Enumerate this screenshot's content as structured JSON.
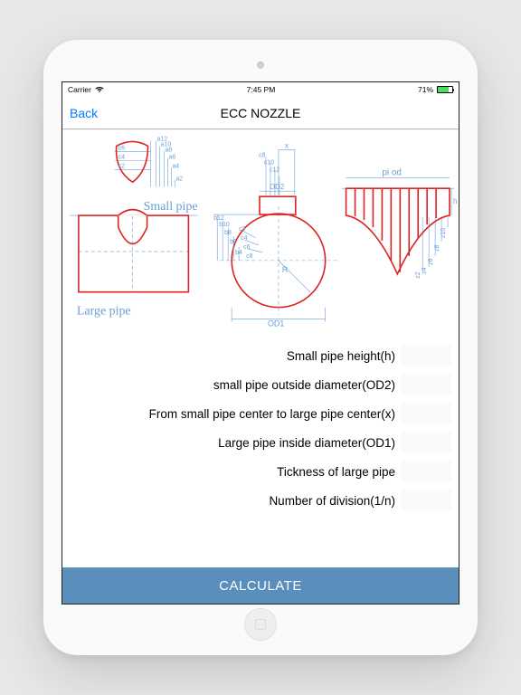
{
  "status": {
    "carrier": "Carrier",
    "time": "7:45 PM",
    "battery_pct": "71%"
  },
  "nav": {
    "back_label": "Back",
    "title": "ECC NOZZLE"
  },
  "diagram": {
    "small_pipe_label": "Small pipe",
    "large_pipe_label": "Large pipe",
    "pi_od_label": "pi  od",
    "od1_label": "OD1",
    "od2_label": "OD2",
    "r_label": "R",
    "h_label": "h",
    "a_labels": [
      "a2",
      "a4",
      "a6",
      "a8",
      "a10",
      "a12"
    ],
    "b_labels": [
      "b2",
      "b4",
      "b6",
      "b8",
      "b10",
      "b12"
    ],
    "c_labels_left": [
      "c2",
      "c4",
      "c6"
    ],
    "c_labels_top": [
      "c8",
      "c10",
      "c12"
    ],
    "c_labels_arc": [
      "c2",
      "c4",
      "c6",
      "c8",
      "c10",
      "c12"
    ],
    "z_labels": [
      "z2",
      "z4",
      "z6",
      "z8",
      "z10",
      "z12"
    ],
    "x_label": "x"
  },
  "form": {
    "rows": [
      {
        "label": "Small pipe height(h)",
        "value": ""
      },
      {
        "label": "small pipe outside diameter(OD2)",
        "value": ""
      },
      {
        "label": "From small pipe center to large pipe center(x)",
        "value": ""
      },
      {
        "label": "Large pipe inside diameter(OD1)",
        "value": ""
      },
      {
        "label": "Tickness of large pipe",
        "value": ""
      },
      {
        "label": "Number of division(1/n)",
        "value": ""
      }
    ]
  },
  "button": {
    "calculate": "CALCULATE"
  }
}
